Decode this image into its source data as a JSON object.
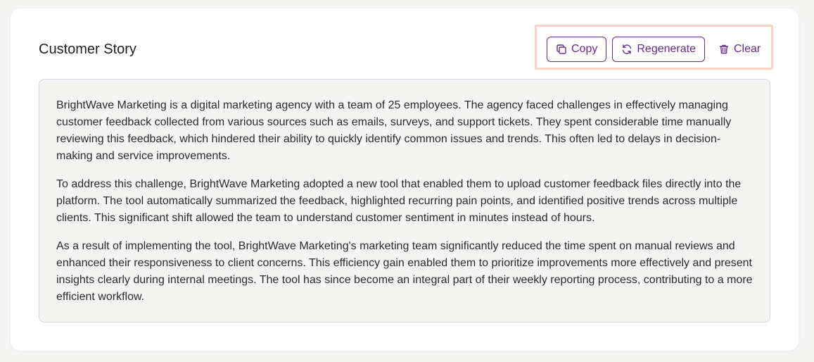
{
  "header": {
    "title": "Customer Story"
  },
  "actions": {
    "copy_label": "Copy",
    "regenerate_label": "Regenerate",
    "clear_label": "Clear",
    "accent_color": "#6b2a8c",
    "highlight_color": "#fbd6c6"
  },
  "icons": {
    "copy": "copy-icon",
    "regenerate": "refresh-icon",
    "clear": "trash-icon"
  },
  "story": {
    "paragraphs": [
      "BrightWave Marketing is a digital marketing agency with a team of 25 employees. The agency faced challenges in effectively managing customer feedback collected from various sources such as emails, surveys, and support tickets. They spent considerable time manually reviewing this feedback, which hindered their ability to quickly identify common issues and trends. This often led to delays in decision-making and service improvements.",
      "To address this challenge, BrightWave Marketing adopted a new tool that enabled them to upload customer feedback files directly into the platform. The tool automatically summarized the feedback, highlighted recurring pain points, and identified positive trends across multiple clients. This significant shift allowed the team to understand customer sentiment in minutes instead of hours.",
      "As a result of implementing the tool, BrightWave Marketing's marketing team significantly reduced the time spent on manual reviews and enhanced their responsiveness to client concerns. This efficiency gain enabled them to prioritize improvements more effectively and present insights clearly during internal meetings. The tool has since become an integral part of their weekly reporting process, contributing to a more efficient workflow."
    ]
  }
}
